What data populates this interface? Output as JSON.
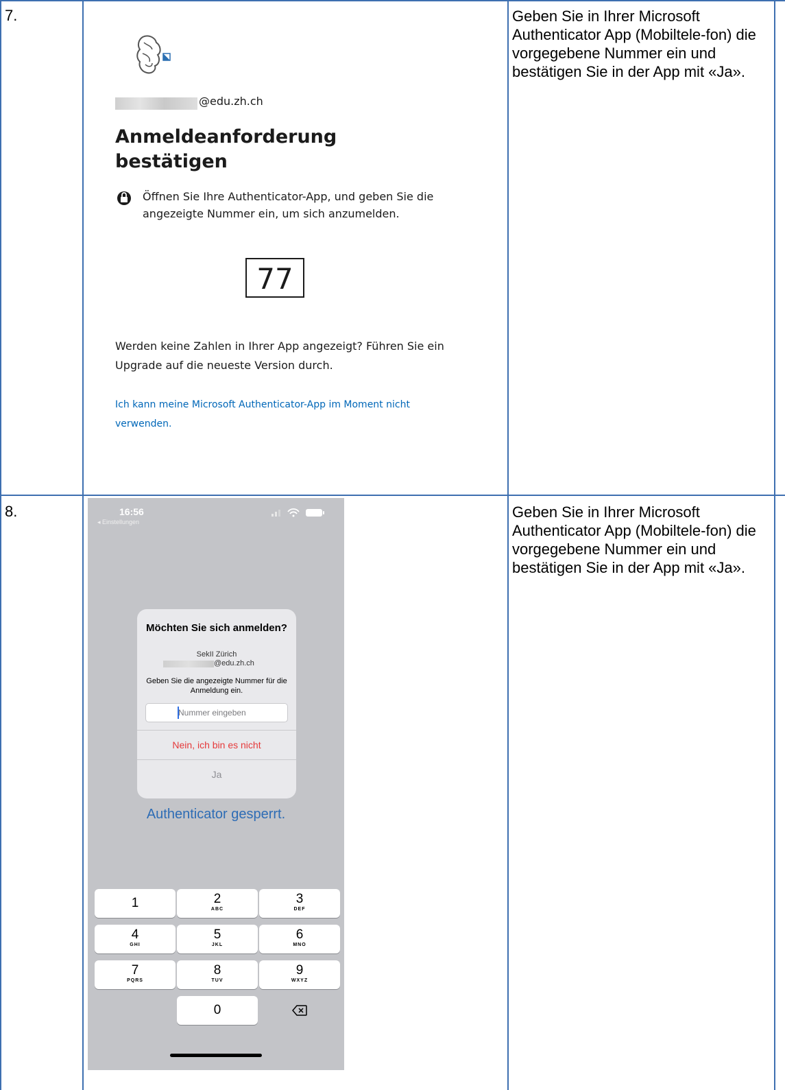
{
  "rows": [
    {
      "number": "7.",
      "description": "Geben Sie in Ihrer Microsoft Authenticator App (Mobiltele-fon) die vorgegebene Nummer ein und bestätigen Sie in der App mit «Ja»."
    },
    {
      "number": "8.",
      "description": "Geben Sie in Ihrer Microsoft Authenticator App (Mobiltele-fon) die vorgegebene Nummer ein und bestätigen Sie in der App mit «Ja»."
    }
  ],
  "signin": {
    "email_suffix": "@edu.zh.ch",
    "title": "Anmeldeanforderung bestätigen",
    "instruction": "Öffnen Sie Ihre Authenticator-App, und geben Sie die angezeigte Nummer ein, um sich anzumelden.",
    "number": "77",
    "upgrade_text": "Werden keine Zahlen in Ihrer App angezeigt? Führen Sie ein Upgrade auf die neueste Version durch.",
    "cannot_use_link": "Ich kann meine Microsoft Authenticator-App im Moment nicht verwenden.",
    "link_color": "#0067b8"
  },
  "phone": {
    "time": "16:56",
    "back_label": "◂ Einstellungen",
    "dialog": {
      "title": "Möchten Sie sich anmelden?",
      "org": "SekII Zürich",
      "email_suffix": "@edu.zh.ch",
      "prompt": "Geben Sie die angezeigte Nummer für die Anmeldung ein.",
      "input_placeholder": "Nummer eingeben",
      "deny_label": "Nein, ich bin es nicht",
      "confirm_label": "Ja"
    },
    "locked_text": "Authenticator gesperrt.",
    "keys": [
      {
        "num": "1",
        "letters": ""
      },
      {
        "num": "2",
        "letters": "ABC"
      },
      {
        "num": "3",
        "letters": "DEF"
      },
      {
        "num": "4",
        "letters": "GHI"
      },
      {
        "num": "5",
        "letters": "JKL"
      },
      {
        "num": "6",
        "letters": "MNO"
      },
      {
        "num": "7",
        "letters": "PQRS"
      },
      {
        "num": "8",
        "letters": "TUV"
      },
      {
        "num": "9",
        "letters": "WXYZ"
      },
      {
        "num": "0",
        "letters": ""
      }
    ],
    "delete_icon": "backspace-icon"
  },
  "colors": {
    "table_border": "#3d6fb0",
    "deny_red": "#e5393a",
    "locked_blue": "#2d6cb5"
  }
}
